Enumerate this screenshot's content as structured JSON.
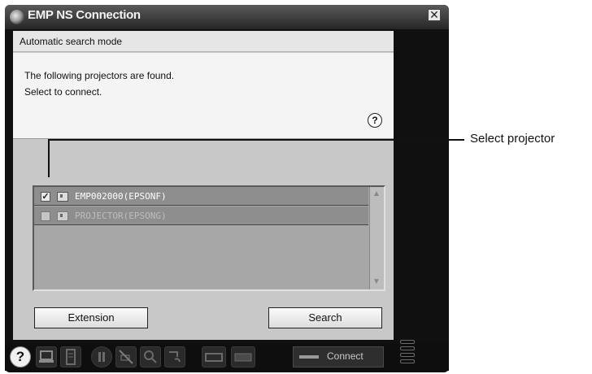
{
  "window": {
    "title": "EMP NS Connection",
    "close_glyph": "✕"
  },
  "panel": {
    "mode_label": "Automatic search mode",
    "message_line1": "The following projectors are found.",
    "message_line2": "Select to connect.",
    "help_glyph": "?"
  },
  "projectors": [
    {
      "name": "EMP002000(EPSONF)",
      "checked": true,
      "check_glyph": "✓"
    },
    {
      "name": "PROJECTOR(EPSONG)",
      "checked": false,
      "check_glyph": ""
    }
  ],
  "scroll": {
    "up_glyph": "▲",
    "down_glyph": "▼"
  },
  "buttons": {
    "extension": "Extension",
    "search": "Search"
  },
  "toolbar": {
    "help_glyph": "?",
    "connect_label": "Connect"
  },
  "callout": {
    "label": "Select projector"
  },
  "colors": {
    "window_bg": "#101010",
    "panel_bg": "#c8c8c8",
    "list_bg": "#a7a7a7",
    "row_bg": "#8e8e8e",
    "enabled_row_text": "#ffffff",
    "disabled_row_text": "#bdbdbd"
  }
}
